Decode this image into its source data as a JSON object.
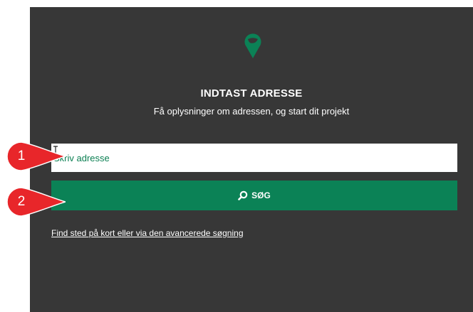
{
  "form": {
    "title": "INDTAST ADRESSE",
    "subtitle": "Få oplysninger om adressen, og start dit projekt",
    "address_placeholder": "Skriv adresse",
    "search_label": "SØG",
    "find_link": "Find sted på kort eller via den avancerede søgning"
  },
  "callouts": [
    "1",
    "2"
  ],
  "icons": {
    "logo": "location-pin-icon",
    "search": "magnifier-icon",
    "cursor": "text-cursor-icon"
  },
  "colors": {
    "panel": "#373737",
    "accent": "#0b8256",
    "callout": "#e8262a"
  }
}
